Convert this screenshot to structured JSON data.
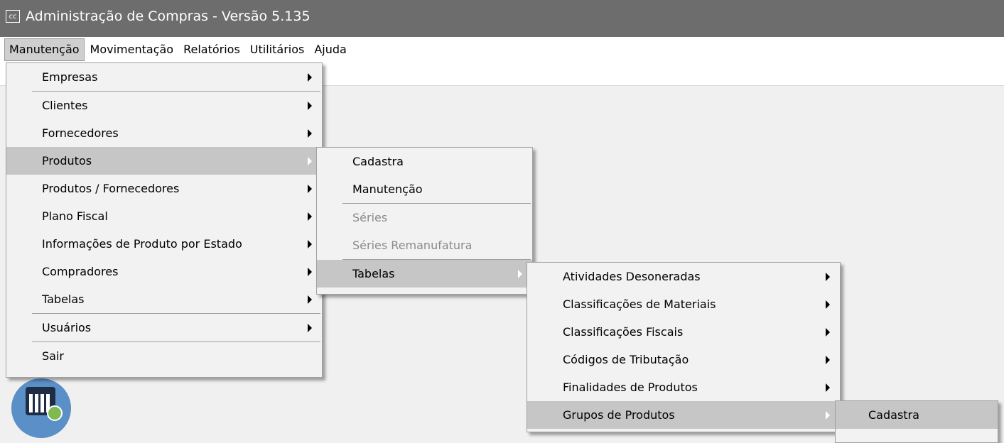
{
  "window": {
    "icon_text": "cc",
    "title": "Administração de Compras - Versão 5.135"
  },
  "menubar": [
    "Manutenção",
    "Movimentação",
    "Relatórios",
    "Utilitários",
    "Ajuda"
  ],
  "menu_manutencao": {
    "items": [
      "Empresas",
      "Clientes",
      "Fornecedores",
      "Produtos",
      "Produtos / Fornecedores",
      "Plano Fiscal",
      "Informações de Produto por Estado",
      "Compradores",
      "Tabelas",
      "Usuários",
      "Sair"
    ]
  },
  "menu_produtos": {
    "items": [
      "Cadastra",
      "Manutenção",
      "Séries",
      "Séries Remanufatura",
      "Tabelas"
    ]
  },
  "menu_tabelas": {
    "items": [
      "Atividades Desoneradas",
      "Classificações de Materiais",
      "Classificações Fiscais",
      "Códigos de Tributação",
      "Finalidades de Produtos",
      "Grupos de Produtos"
    ]
  },
  "menu_grupos": {
    "items": [
      "Cadastra"
    ]
  },
  "icons": {
    "calendar_shortcut": "calendar-money-icon"
  }
}
